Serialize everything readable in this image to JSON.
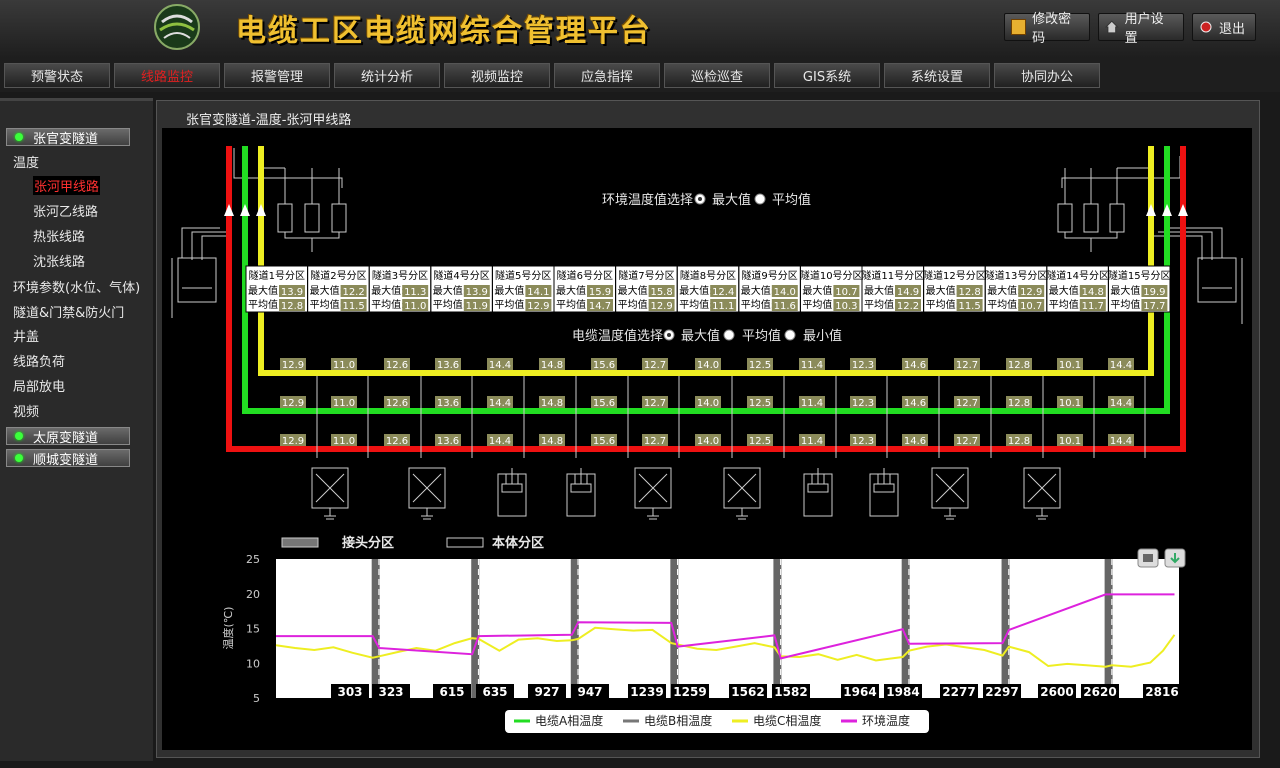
{
  "app": {
    "title": "电缆工区电缆网综合管理平台"
  },
  "header_buttons": [
    {
      "label": "修改密码",
      "icon": "key-icon"
    },
    {
      "label": "用户设置",
      "icon": "home-icon"
    },
    {
      "label": "退出",
      "icon": "power-icon"
    }
  ],
  "nav": {
    "tabs": [
      "预警状态",
      "线路监控",
      "报警管理",
      "统计分析",
      "视频监控",
      "应急指挥",
      "巡检巡查",
      "GIS系统",
      "系统设置",
      "协同办公"
    ],
    "active_index": 1
  },
  "sidebar": {
    "groups": [
      {
        "label": "张官变隧道"
      },
      {
        "label": "太原变隧道"
      },
      {
        "label": "顺城变隧道"
      }
    ],
    "items": [
      "温度",
      "环境参数(水位、气体)",
      "隧道&门禁&防火门",
      "井盖",
      "线路负荷",
      "局部放电",
      "视频"
    ],
    "sub_items": [
      "张河甲线路",
      "张河乙线路",
      "热张线路",
      "沈张线路"
    ],
    "active_sub": 0
  },
  "breadcrumb": "张官变隧道-温度-张河甲线路",
  "env_select": {
    "label": "环境温度值选择",
    "options": [
      "最大值",
      "平均值"
    ],
    "selected": 0
  },
  "cable_select": {
    "label": "电缆温度值选择",
    "options": [
      "最大值",
      "平均值",
      "最小值"
    ],
    "selected": 0
  },
  "zones": {
    "names": [
      "隧道1号分区",
      "隧道2号分区",
      "隧道3号分区",
      "隧道4号分区",
      "隧道5号分区",
      "隧道6号分区",
      "隧道7号分区",
      "隧道8号分区",
      "隧道9号分区",
      "隧道10号分区",
      "隧道11号分区",
      "隧道12号分区",
      "隧道13号分区",
      "隧道14号分区",
      "隧道15号分区"
    ],
    "max_label": "最大值:",
    "avg_label": "平均值:",
    "max": [
      "13.9",
      "12.2",
      "11.3",
      "13.9",
      "14.1",
      "15.9",
      "15.8",
      "12.4",
      "14.0",
      "10.7",
      "14.9",
      "12.8",
      "12.9",
      "14.8",
      "19.9"
    ],
    "avg": [
      "12.8",
      "11.5",
      "11.0",
      "11.9",
      "12.9",
      "14.7",
      "12.9",
      "11.1",
      "11.6",
      "10.3",
      "12.2",
      "11.5",
      "10.7",
      "11.7",
      "17.7"
    ]
  },
  "cable_values": [
    "12.9",
    "11.0",
    "12.6",
    "13.6",
    "14.4",
    "14.8",
    "15.6",
    "12.7",
    "14.0",
    "12.5",
    "11.4",
    "12.3",
    "14.6",
    "12.7",
    "12.8",
    "10.1",
    "14.4"
  ],
  "colors": {
    "phaseA": "#22dd22",
    "phaseB": "#777777",
    "phaseC": "#eeee22",
    "env": "#dd22dd",
    "red": "#ee1111"
  },
  "zone_legend": {
    "joint": "接头分区",
    "body": "本体分区"
  },
  "chart_data": {
    "type": "line",
    "ylabel": "温度(℃)",
    "ylim": [
      5,
      25
    ],
    "yticks": [
      5,
      10,
      15,
      20,
      25
    ],
    "xlim": [
      0,
      2830
    ],
    "x_tick_labels": [
      "303",
      "323",
      "615",
      "635",
      "927",
      "947",
      "1239",
      "1259",
      "1562",
      "1582",
      "1964",
      "1984",
      "2277",
      "2297",
      "2600",
      "2620",
      "2816"
    ],
    "joint_bands": [
      [
        303,
        323
      ],
      [
        615,
        635
      ],
      [
        927,
        947
      ],
      [
        1239,
        1259
      ],
      [
        1562,
        1582
      ],
      [
        1964,
        1984
      ],
      [
        2277,
        2297
      ],
      [
        2600,
        2620
      ]
    ],
    "series": [
      {
        "name": "电缆A相温度",
        "color": "#22dd22",
        "x": [],
        "y": []
      },
      {
        "name": "电缆B相温度",
        "color": "#777777",
        "x": [],
        "y": []
      },
      {
        "name": "电缆C相温度",
        "color": "#eeee22",
        "x": [
          0,
          60,
          120,
          180,
          240,
          303,
          323,
          380,
          440,
          500,
          560,
          615,
          635,
          700,
          760,
          820,
          880,
          927,
          947,
          1000,
          1060,
          1120,
          1180,
          1239,
          1259,
          1320,
          1380,
          1440,
          1500,
          1562,
          1582,
          1640,
          1700,
          1760,
          1820,
          1880,
          1964,
          1984,
          2040,
          2100,
          2160,
          2220,
          2277,
          2297,
          2360,
          2420,
          2480,
          2540,
          2600,
          2620,
          2680,
          2740,
          2780,
          2816
        ],
        "y": [
          12.6,
          12.2,
          11.9,
          12.3,
          11.5,
          10.8,
          11.0,
          11.6,
          12.2,
          11.8,
          12.9,
          13.6,
          13.5,
          11.8,
          13.4,
          13.6,
          13.2,
          13.3,
          13.5,
          15.1,
          14.9,
          14.7,
          14.8,
          12.9,
          12.7,
          12.1,
          11.9,
          12.4,
          12.9,
          12.3,
          11.0,
          10.9,
          11.3,
          10.5,
          11.2,
          10.4,
          10.9,
          11.8,
          12.4,
          12.7,
          12.3,
          11.9,
          11.1,
          12.4,
          11.6,
          9.6,
          9.9,
          9.7,
          9.5,
          9.7,
          9.5,
          10.1,
          11.8,
          14.1
        ]
      },
      {
        "name": "环境温度",
        "color": "#dd22dd",
        "x": [
          0,
          303,
          323,
          615,
          635,
          927,
          947,
          1239,
          1259,
          1562,
          1582,
          1964,
          1984,
          2277,
          2297,
          2600,
          2620,
          2816
        ],
        "y": [
          13.9,
          13.9,
          12.2,
          11.3,
          13.9,
          14.1,
          15.9,
          15.8,
          12.4,
          14.0,
          10.7,
          14.9,
          12.8,
          12.9,
          14.8,
          19.9,
          19.9,
          19.9
        ]
      }
    ]
  }
}
